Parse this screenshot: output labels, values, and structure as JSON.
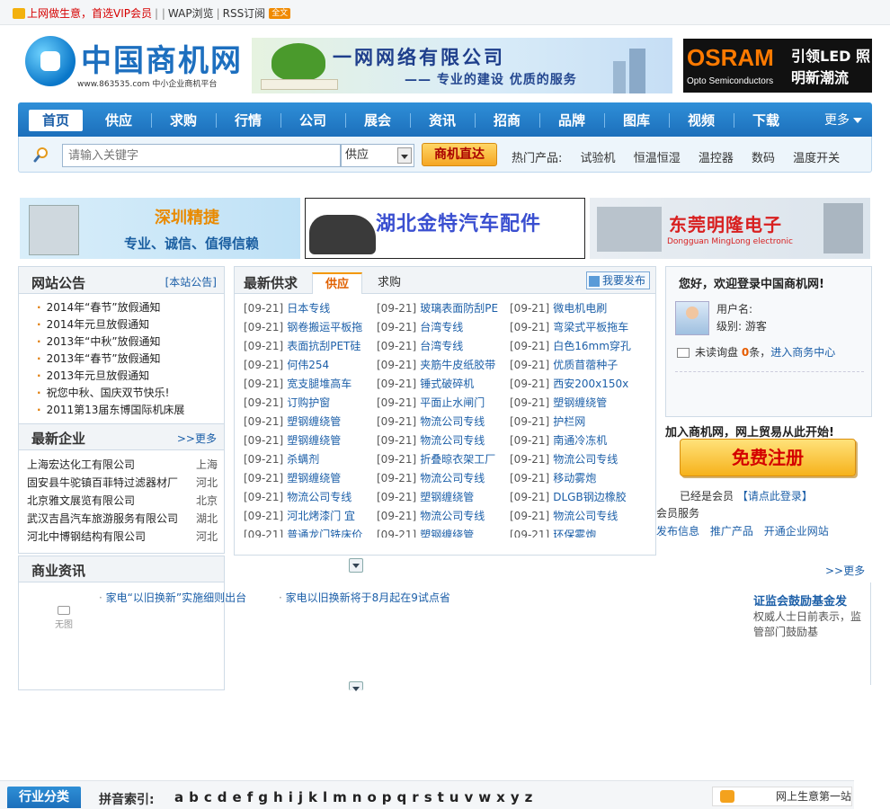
{
  "topbar": {
    "vip_text": "上网做生意，首选VIP会员",
    "sep1": "| |",
    "wap": "WAP浏览",
    "sep2": "|",
    "rss": "RSS订阅",
    "rss_badge": "全文"
  },
  "logo": {
    "name": "中国商机网",
    "url_sub": "www.863535.com 中小企业商机平台"
  },
  "banner_mid": {
    "title": "一网网络有限公司",
    "subtitle": "—— 专业的建设 优质的服务"
  },
  "banner_osram": {
    "brand": "OSRAM",
    "brand_sub": "Opto Semiconductors",
    "slogan": "引领LED 照明新潮流"
  },
  "nav": {
    "items": [
      "首页",
      "供应",
      "求购",
      "行情",
      "公司",
      "展会",
      "资讯",
      "招商",
      "品牌",
      "图库",
      "视频",
      "下载"
    ],
    "more": "更多"
  },
  "search": {
    "placeholder": "请输入关键字",
    "select_value": "供应",
    "button": "商机直达",
    "hot_label": "热门产品:",
    "hot_items": [
      "试验机",
      "恒温恒湿",
      "温控器",
      "数码",
      "温度开关"
    ]
  },
  "ads": {
    "ad1_title": "深圳精捷",
    "ad1_sub": "专业、诚信、值得信赖",
    "ad2_title": "湖北金特汽车配件",
    "ad3_title": "东莞明隆电子",
    "ad3_sub": "Dongguan MingLong electronic"
  },
  "notice": {
    "title": "网站公告",
    "link": "[本站公告]",
    "items": [
      "2014年“春节”放假通知",
      "2014年元旦放假通知",
      "2013年“中秋”放假通知",
      "2013年“春节”放假通知",
      "2013年元旦放假通知",
      "祝您中秋、国庆双节快乐!",
      "2011第13届东博国际机床展"
    ]
  },
  "companies": {
    "title": "最新企业",
    "more": ">>更多",
    "rows": [
      {
        "name": "上海宏达化工有限公司",
        "region": "上海"
      },
      {
        "name": "固安县牛驼镇百菲特过滤器材厂",
        "region": "河北"
      },
      {
        "name": "北京雅文展览有限公司",
        "region": "北京"
      },
      {
        "name": "武汉吉昌汽车旅游服务有限公司",
        "region": "湖北"
      },
      {
        "name": "河北中博钢结构有限公司",
        "region": "河北"
      }
    ]
  },
  "supply": {
    "title": "最新供求",
    "tab_supply": "供应",
    "tab_demand": "求购",
    "publish": "我要发布",
    "date": "[09-21]",
    "rows": [
      [
        "日本专线",
        "玻璃表面防刮PE",
        "微电机电刷"
      ],
      [
        "钢卷搬运平板拖",
        "台湾专线",
        "弯梁式平板拖车"
      ],
      [
        "表面抗刮PET硅",
        "台湾专线",
        "白色16mm穿孔"
      ],
      [
        "何伟254",
        "夹筋牛皮纸胶带",
        "优质苜蓿种子"
      ],
      [
        "宽支腿堆高车",
        "锤式破碎机",
        "西安200x150x"
      ],
      [
        "订购护窗",
        "平面止水闸门",
        "塑钢缠绕管"
      ],
      [
        "塑钢缠绕管",
        "物流公司专线",
        "护栏网"
      ],
      [
        "塑钢缠绕管",
        "物流公司专线",
        "南通冷冻机"
      ],
      [
        "杀螨剂",
        "折叠晾衣架工厂",
        "物流公司专线"
      ],
      [
        "塑钢缠绕管",
        "物流公司专线",
        "移动雾炮"
      ],
      [
        "物流公司专线",
        "塑钢缠绕管",
        "DLGB钢边橡胶"
      ],
      [
        "河北烤漆门 宜",
        "物流公司专线",
        "物流公司专线"
      ],
      [
        "普通龙门铣床价",
        "塑钢缠绕管",
        "环保雾炮"
      ]
    ]
  },
  "login": {
    "title": "您好，欢迎登录中国商机网!",
    "username_label": "用户名:",
    "level_label": "级别: 游客",
    "unread_label": "未读询盘",
    "unread_count": "0",
    "unread_unit": "条，",
    "center_link": "进入商务中心"
  },
  "join": {
    "text": "加入商机网，网上贸易从此开始!",
    "register": "免费注册",
    "member_prefix": "已经是会员",
    "member_link": "【请点此登录】",
    "svc_title": "会员服务",
    "svc_links": [
      "发布信息",
      "推广产品",
      "开通企业网站"
    ],
    "more": ">>更多"
  },
  "news": {
    "title": "商业资讯",
    "no_image": "无图",
    "items": [
      "家电“以旧换新”实施细则出台",
      "家电以旧换新将于8月起在9试点省"
    ],
    "featured_title": "证监会鼓励基金发",
    "featured_text": "权威人士日前表示，监管部门鼓励基"
  },
  "bottom": {
    "category": "行业分类",
    "pinyin_label": "拼音索引:",
    "letters": [
      "a",
      "b",
      "c",
      "d",
      "e",
      "f",
      "g",
      "h",
      "i",
      "j",
      "k",
      "l",
      "m",
      "n",
      "o",
      "p",
      "q",
      "r",
      "s",
      "t",
      "u",
      "v",
      "w",
      "x",
      "y",
      "z"
    ],
    "slogan": "网上生意第一站"
  }
}
